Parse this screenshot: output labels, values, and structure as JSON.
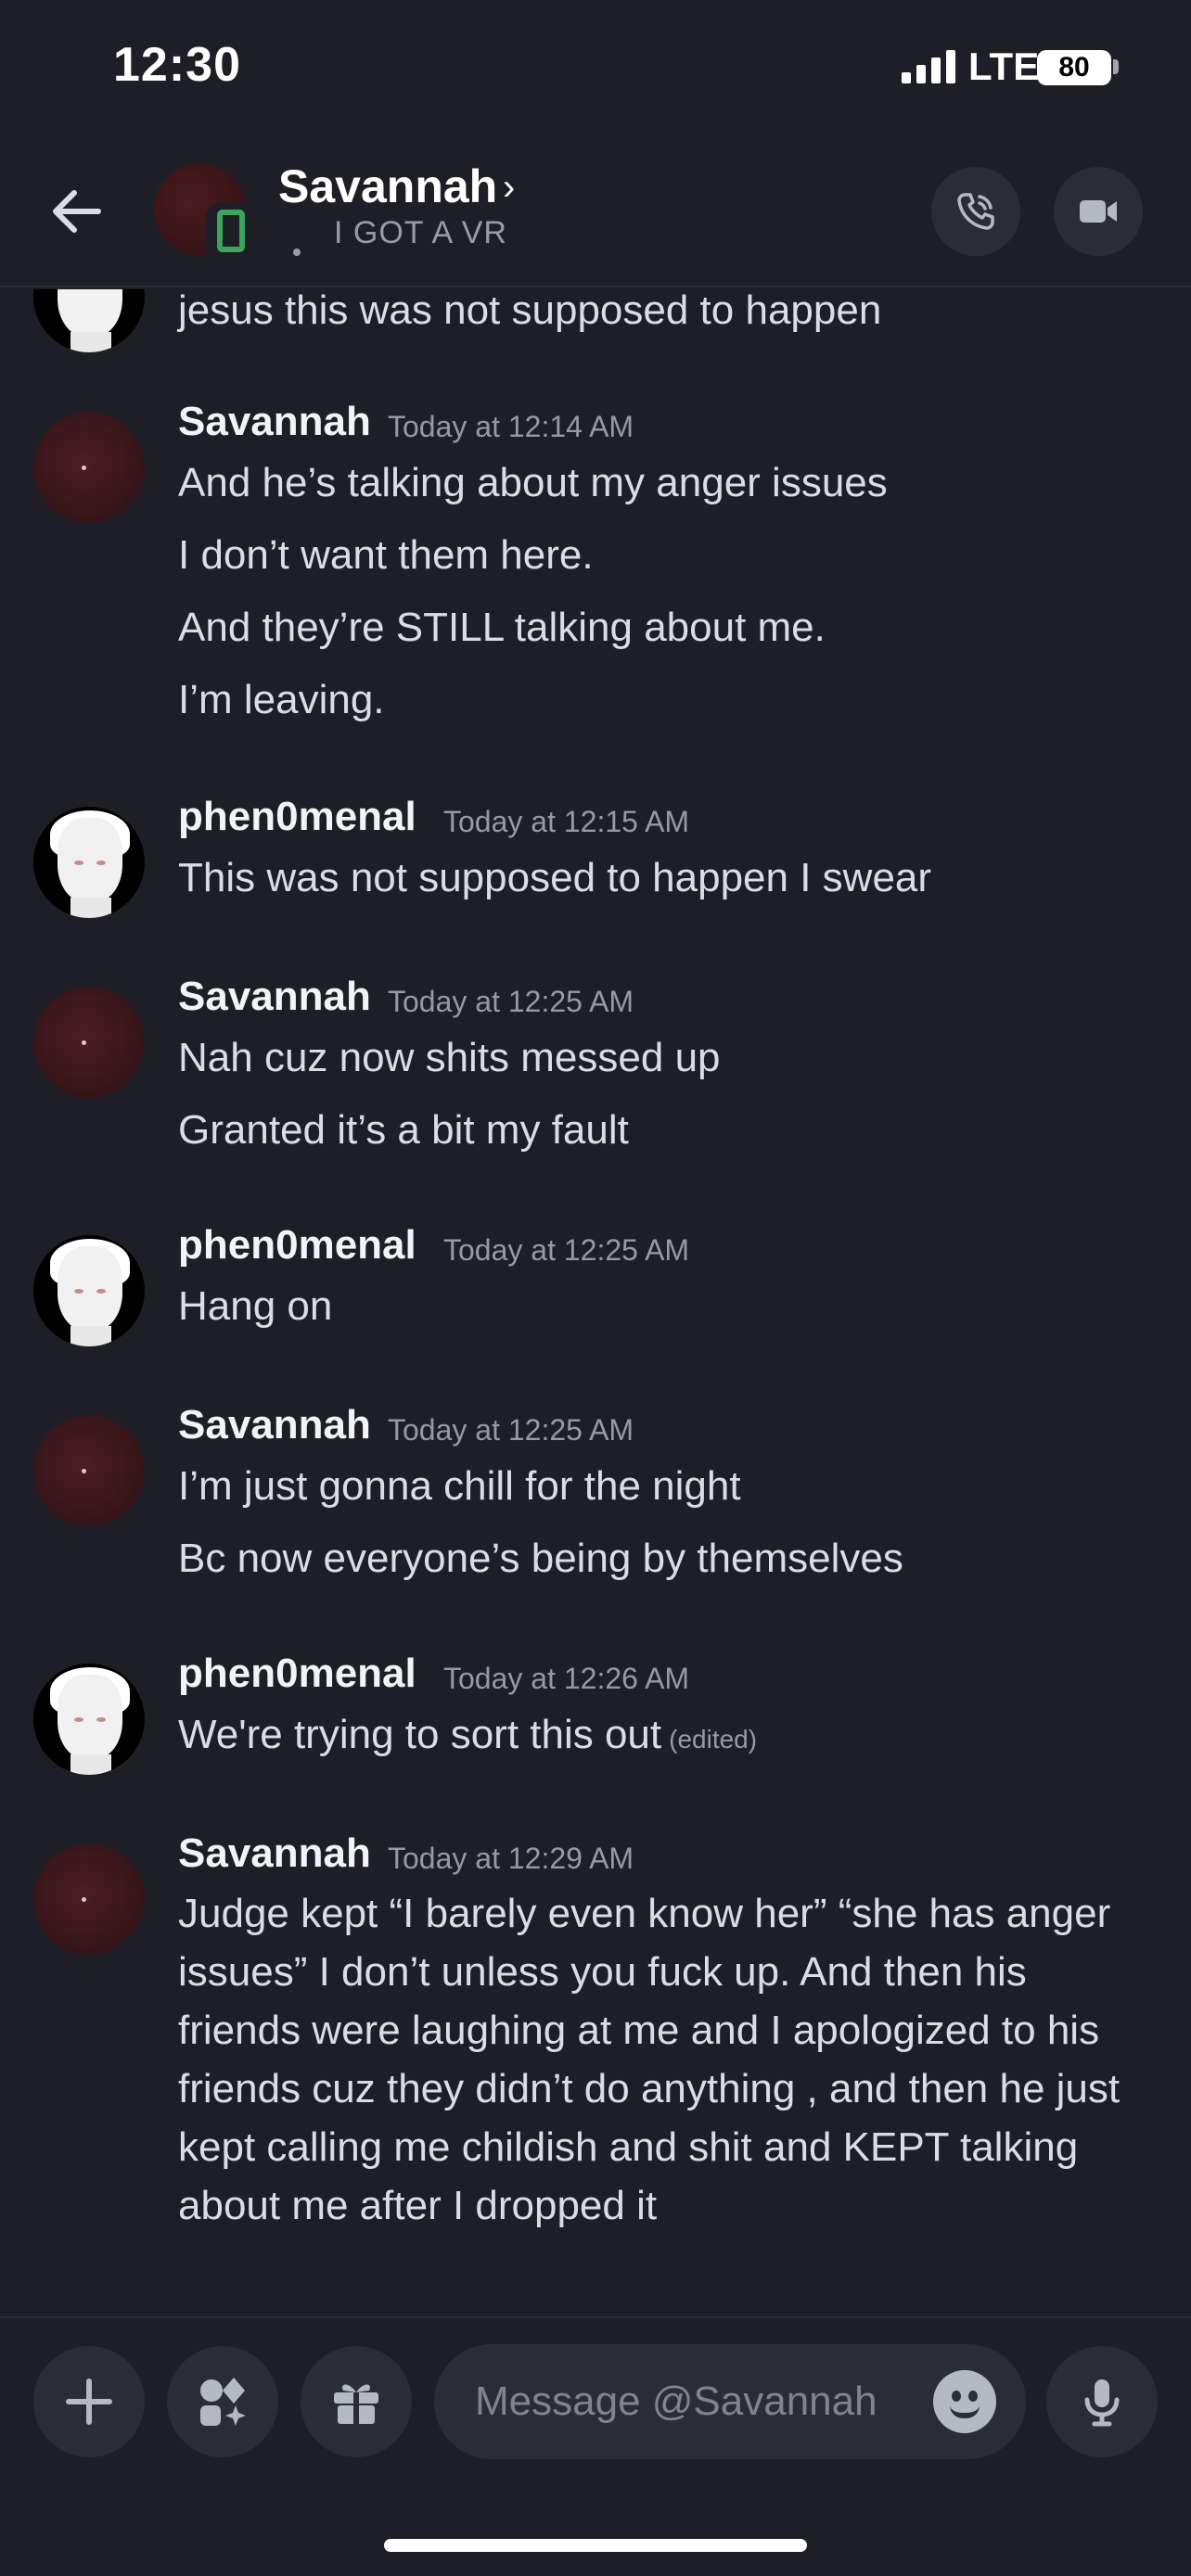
{
  "status_bar": {
    "time": "12:30",
    "network": "LTE",
    "battery": "80"
  },
  "header": {
    "name": "Savannah",
    "chevron": "›",
    "custom_status": "I GOT A VR",
    "call_icon": "phone-call-icon",
    "video_icon": "video-camera-icon"
  },
  "messages": {
    "partial_top": {
      "text": "jesus this was not supposed to happen"
    },
    "m1": {
      "author": "Savannah",
      "timestamp": "Today at 12:14 AM",
      "lines": [
        "And he’s talking about my anger issues",
        "I don’t want them here.",
        "And they’re STILL talking about me.",
        "I’m leaving."
      ]
    },
    "m2": {
      "author": "phen0menal",
      "timestamp": "Today at 12:15 AM",
      "lines": [
        "This was not supposed to happen I swear"
      ]
    },
    "m3": {
      "author": "Savannah",
      "timestamp": "Today at 12:25 AM",
      "lines": [
        "Nah cuz now shits messed up",
        "Granted it’s a bit my fault"
      ]
    },
    "m4": {
      "author": "phen0menal",
      "timestamp": "Today at 12:25 AM",
      "lines": [
        "Hang on"
      ]
    },
    "m5": {
      "author": "Savannah",
      "timestamp": "Today at 12:25 AM",
      "lines": [
        "I’m just gonna chill for the night",
        "Bc now everyone’s being by themselves"
      ]
    },
    "m6": {
      "author": "phen0menal",
      "timestamp": "Today at 12:26 AM",
      "lines": [
        "We're trying to sort this out"
      ],
      "edited": "(edited)"
    },
    "m7": {
      "author": "Savannah",
      "timestamp": "Today at 12:29 AM",
      "text": "Judge kept “I barely even know her” “she has anger issues” I don’t unless you fuck up. And then his friends were laughing at me and I apologized to his friends cuz they didn’t do anything , and then he just kept calling me childish and shit and KEPT talking about me after I dropped it"
    }
  },
  "composer": {
    "placeholder": "Message @Savannah",
    "icons": [
      "plus-icon",
      "apps-icon",
      "gift-icon",
      "emoji-icon",
      "microphone-icon"
    ]
  }
}
